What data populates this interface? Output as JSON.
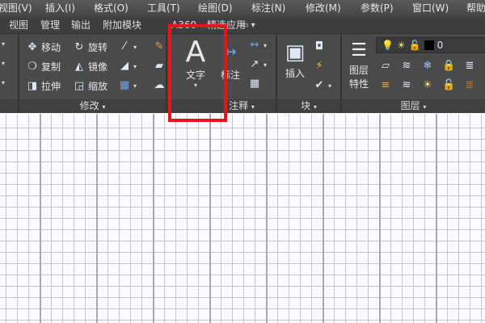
{
  "menu": [
    "视图(V)",
    "插入(I)",
    "格式(O)",
    "工具(T)",
    "绘图(D)",
    "标注(N)",
    "修改(M)",
    "参数(P)",
    "窗口(W)",
    "帮助"
  ],
  "tabs": [
    "视图",
    "管理",
    "输出",
    "附加模块",
    "A360",
    "精选应用"
  ],
  "modify": {
    "title": "修改",
    "move": "移动",
    "rotate": "旋转",
    "copy": "复制",
    "mirror": "镜像",
    "stretch": "拉伸",
    "scale": "缩放"
  },
  "annotation": {
    "title": "注释",
    "text": "文字",
    "dimension": "标注"
  },
  "block": {
    "title": "块",
    "insert": "插入"
  },
  "layers": {
    "title": "图层",
    "properties_line1": "图层",
    "properties_line2": "特性",
    "current_layer": "0"
  },
  "colors": {
    "highlight": "#e8141c"
  }
}
